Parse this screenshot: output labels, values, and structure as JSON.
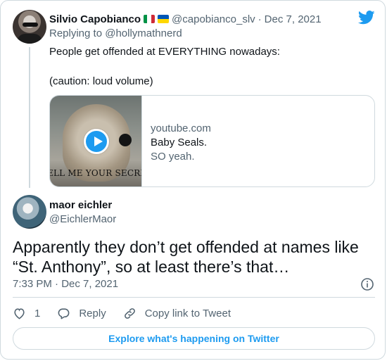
{
  "parent": {
    "name": "Silvio Capobianco",
    "handle": "@capobianco_slv",
    "dot": "·",
    "date": "Dec 7, 2021",
    "replying_to": "Replying to @hollymathnerd",
    "text_line1": "People get offended at EVERYTHING nowadays:",
    "text_line2": "(caution: loud volume)",
    "flags": [
      "italy-flag-icon",
      "ukraine-flag-icon"
    ]
  },
  "link_card": {
    "thumbnail_text": "ELL ME YOUR SECRET",
    "domain": "youtube.com",
    "title": "Baby Seals.",
    "description": "SO yeah."
  },
  "tweet": {
    "name": "maor eichler",
    "handle": "@EichlerMaor",
    "text": "Apparently they don’t get offended at names like “St. Anthony”, so at least there’s that…",
    "timestamp": "7:33 PM · Dec 7, 2021"
  },
  "actions": {
    "like_count": "1",
    "reply_label": "Reply",
    "copy_link_label": "Copy link to Tweet"
  },
  "explore_label": "Explore what's happening on Twitter",
  "colors": {
    "accent": "#1d9bf0",
    "text": "#0f1419",
    "secondary": "#536471",
    "border": "#cfd9de"
  }
}
